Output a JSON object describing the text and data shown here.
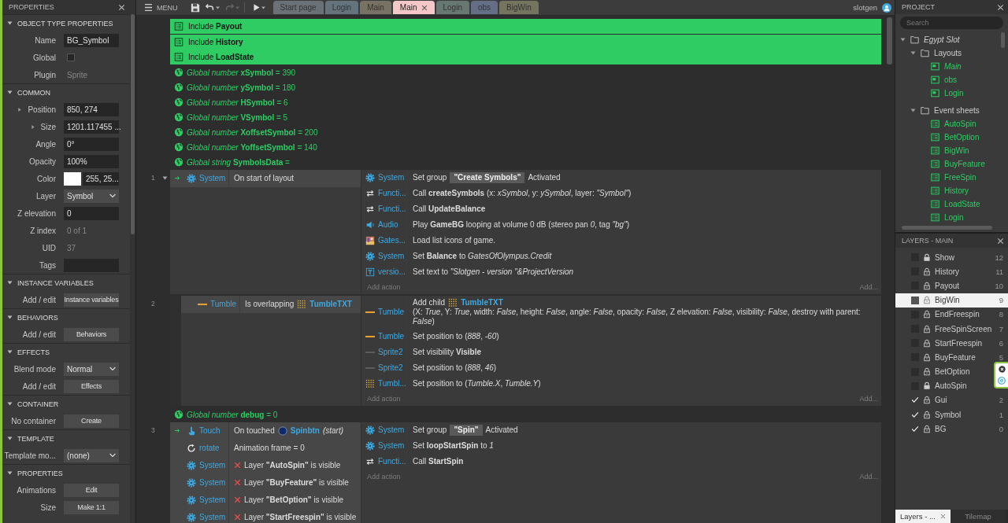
{
  "properties_panel": {
    "title": "PROPERTIES",
    "sections": [
      {
        "title": "OBJECT TYPE PROPERTIES",
        "expanded": true,
        "rows": [
          {
            "label": "Name",
            "kind": "field",
            "value": "BG_Symbol"
          },
          {
            "label": "Global",
            "kind": "check",
            "checked": false
          },
          {
            "label": "Plugin",
            "kind": "text",
            "value": "Sprite"
          }
        ]
      },
      {
        "title": "COMMON",
        "expanded": true,
        "rows": [
          {
            "label": "Position",
            "kind": "field",
            "value": "850, 274",
            "expanded": false
          },
          {
            "label": "Size",
            "kind": "field",
            "value": "1201.117455 ...",
            "expanded": false
          },
          {
            "label": "Angle",
            "kind": "field",
            "value": "0°"
          },
          {
            "label": "Opacity",
            "kind": "field",
            "value": "100%"
          },
          {
            "label": "Color",
            "kind": "color",
            "color": "#ffffff",
            "value": "255, 25..."
          },
          {
            "label": "Layer",
            "kind": "select",
            "value": "Symbol"
          },
          {
            "label": "Z elevation",
            "kind": "field",
            "value": "0"
          },
          {
            "label": "Z index",
            "kind": "text",
            "value": "0 of 1"
          },
          {
            "label": "UID",
            "kind": "text",
            "value": "37"
          },
          {
            "label": "Tags",
            "kind": "field"
          }
        ]
      },
      {
        "title": "INSTANCE VARIABLES",
        "expanded": true,
        "rows": [
          {
            "label": "Add / edit",
            "kind": "button",
            "value": "Instance variables"
          }
        ]
      },
      {
        "title": "BEHAVIORS",
        "expanded": true,
        "rows": [
          {
            "label": "Add / edit",
            "kind": "button",
            "value": "Behaviors"
          }
        ]
      },
      {
        "title": "EFFECTS",
        "expanded": true,
        "rows": [
          {
            "label": "Blend mode",
            "kind": "select",
            "value": "Normal"
          },
          {
            "label": "Add / edit",
            "kind": "button",
            "value": "Effects"
          }
        ]
      },
      {
        "title": "CONTAINER",
        "expanded": true,
        "rows": [
          {
            "label": "No container",
            "kind": "button",
            "value": "Create"
          }
        ]
      },
      {
        "title": "TEMPLATE",
        "expanded": true,
        "rows": [
          {
            "label": "Template mo...",
            "kind": "select",
            "value": "(none)"
          }
        ]
      },
      {
        "title": "PROPERTIES",
        "expanded": true,
        "rows": [
          {
            "label": "Animations",
            "kind": "button",
            "value": "Edit"
          },
          {
            "label": "Size",
            "kind": "button",
            "value": "Make 1:1"
          }
        ]
      }
    ]
  },
  "toolbar": {
    "menu": "MENU",
    "tabs": [
      {
        "label": "Start page",
        "selected": false,
        "color": "#6a7177"
      },
      {
        "label": "Login",
        "selected": false,
        "color": "#65747c"
      },
      {
        "label": "Main",
        "selected": false,
        "color": "#777263"
      },
      {
        "label": "Main",
        "selected": true,
        "color": "#f6c7c7"
      },
      {
        "label": "Login",
        "selected": false,
        "color": "#677771"
      },
      {
        "label": "obs",
        "selected": false,
        "color": "#646e86"
      },
      {
        "label": "BigWin",
        "selected": false,
        "color": "#75745e"
      }
    ],
    "user": "slotgen"
  },
  "event_sheet": {
    "rows": [
      {
        "kind": "include",
        "text": "Include **Payout**"
      },
      {
        "kind": "include",
        "text": "Include **History**"
      },
      {
        "kind": "include",
        "text": "Include **LoadState**"
      },
      {
        "kind": "global",
        "text": "*Global number* **xSymbol** = 390"
      },
      {
        "kind": "global",
        "text": "*Global number* **ySymbol** = 180"
      },
      {
        "kind": "global",
        "text": "*Global number* **HSymbol** = 6"
      },
      {
        "kind": "global",
        "text": "*Global number* **VSymbol** = 5"
      },
      {
        "kind": "global",
        "text": "*Global number* **XoffsetSymbol** = 200"
      },
      {
        "kind": "global",
        "text": "*Global number* **YoffsetSymbol** = 140"
      },
      {
        "kind": "global",
        "text": "*Global string* **SymbolsData** ="
      },
      {
        "kind": "event",
        "number": "1",
        "expanded": true,
        "trigger": true,
        "sub": false,
        "add_action": "Add action",
        "add_more": "Add...",
        "conditions": [
          {
            "object": "System",
            "kind": "system",
            "text": "On start of layout"
          }
        ],
        "actions": [
          {
            "object": "System",
            "kind": "system",
            "parts": [
              {
                "kind": "text",
                "text": "Set group"
              },
              {
                "kind": "chip",
                "text": "\"Create Symbols\""
              },
              {
                "kind": "text",
                "text": "Activated"
              }
            ]
          },
          {
            "object": "Functi...",
            "kind": "function",
            "text": "Call **createSymbols** (x: *xSymbol*, y: *ySymbol*, layer: *\"Symbol\"*)"
          },
          {
            "object": "Functi...",
            "kind": "function",
            "text": "Call **UpdateBalance**"
          },
          {
            "object": "Audio",
            "kind": "audio",
            "text": "Play **GameBG** looping at volume 0 dB (stereo pan *0*, tag *\"bg\"*)"
          },
          {
            "object": "Gates...",
            "kind": "image",
            "text": "Load list icons of game."
          },
          {
            "object": "System",
            "kind": "system",
            "text": "Set **Balance** to *GatesOfOlympus.Credit*"
          },
          {
            "object": "versio...",
            "kind": "text",
            "text": "Set text to *\"Slotgen - version \"&ProjectVersion*"
          }
        ]
      },
      {
        "kind": "event",
        "number": "2",
        "trigger": false,
        "sub": true,
        "add_action": "Add action",
        "add_more": "Add...",
        "conditions": [
          {
            "object": "Tumble",
            "kind": "bar",
            "parts": [
              {
                "kind": "text",
                "text": "Is overlapping"
              },
              {
                "kind": "grid_ref",
                "text": "TumbleTXT"
              }
            ]
          }
        ],
        "actions": [
          {
            "object": "Tumble",
            "kind": "bar",
            "parts": [
              {
                "kind": "text",
                "text": "Add child"
              },
              {
                "kind": "grid_ref",
                "text": "TumbleTXT"
              },
              {
                "kind": "text",
                "text": "(X: *True*, Y: *True*, width: *False*, height: *False*, angle: *False*, opacity: *False*, Z elevation: *False*, visibility: *False*, destroy with parent: *False*)"
              }
            ]
          },
          {
            "object": "Tumble",
            "kind": "bar",
            "text": "Set position to (*888*, *-60*)"
          },
          {
            "object": "Sprite2",
            "kind": "line",
            "text": "Set visibility **Visible**"
          },
          {
            "object": "Sprite2",
            "kind": "line",
            "text": "Set position to (*888*, *46*)"
          },
          {
            "object": "Tumbl...",
            "kind": "grid",
            "text": "Set position to (*Tumble.X*, *Tumble.Y*)"
          }
        ]
      },
      {
        "kind": "global",
        "text": "*Global number* **debug** = 0"
      },
      {
        "kind": "event",
        "number": "3",
        "trigger": true,
        "sub": false,
        "add_action": "Add action",
        "add_more": "Add...",
        "conditions": [
          {
            "object": "Touch",
            "kind": "touch",
            "parts": [
              {
                "kind": "text",
                "text": "On touched"
              },
              {
                "kind": "ball_ref",
                "text": "Spinbtn"
              },
              {
                "kind": "text",
                "text": "*(start)*"
              }
            ]
          },
          {
            "object": "rotate",
            "kind": "rotate",
            "text": "Animation frame = 0"
          },
          {
            "object": "System",
            "kind": "system",
            "inverted": true,
            "text": "Layer **\"AutoSpin\"** is visible"
          },
          {
            "object": "System",
            "kind": "system",
            "inverted": true,
            "text": "Layer **\"BuyFeature\"** is visible"
          },
          {
            "object": "System",
            "kind": "system",
            "inverted": true,
            "text": "Layer **\"BetOption\"** is visible"
          },
          {
            "object": "System",
            "kind": "system",
            "inverted": true,
            "text": "Layer **\"StartFreespin\"** is visible"
          }
        ],
        "actions": [
          {
            "object": "System",
            "kind": "system",
            "parts": [
              {
                "kind": "text",
                "text": "Set group"
              },
              {
                "kind": "chip",
                "text": "\"Spin\""
              },
              {
                "kind": "text",
                "text": "Activated"
              }
            ]
          },
          {
            "object": "System",
            "kind": "system",
            "text": "Set **loopStartSpin** to *1*"
          },
          {
            "object": "Functi...",
            "kind": "function",
            "text": "Call **StartSpin**"
          }
        ]
      }
    ]
  },
  "project": {
    "title": "PROJECT",
    "search": {
      "placeholder": "Search"
    },
    "tree": [
      {
        "kind": "folder",
        "label": "Egypt Slot",
        "expanded": true,
        "children": [
          {
            "kind": "folder",
            "label": "Layouts",
            "expanded": true,
            "children": [
              {
                "kind": "layout",
                "label": "Main",
                "active": true
              },
              {
                "kind": "layout",
                "label": "obs",
                "active": false
              },
              {
                "kind": "layout",
                "label": "Login",
                "active": false
              }
            ]
          },
          {
            "kind": "folder",
            "label": "Event sheets",
            "expanded": true,
            "children": [
              {
                "kind": "sheet",
                "label": "AutoSpin"
              },
              {
                "kind": "sheet",
                "label": "BetOption"
              },
              {
                "kind": "sheet",
                "label": "BigWin"
              },
              {
                "kind": "sheet",
                "label": "BuyFeature"
              },
              {
                "kind": "sheet",
                "label": "FreeSpin"
              },
              {
                "kind": "sheet",
                "label": "History"
              },
              {
                "kind": "sheet",
                "label": "LoadState"
              },
              {
                "kind": "sheet",
                "label": "Login"
              }
            ]
          }
        ]
      }
    ]
  },
  "layers": {
    "title": "LAYERS - MAIN",
    "items": [
      {
        "name": "Show",
        "number": "12",
        "visible": false,
        "locked": true,
        "selected": false
      },
      {
        "name": "History",
        "number": "11",
        "visible": false,
        "locked": false,
        "selected": false
      },
      {
        "name": "Payout",
        "number": "10",
        "visible": false,
        "locked": false,
        "selected": false
      },
      {
        "name": "BigWin",
        "number": "9",
        "visible": false,
        "locked": false,
        "selected": true
      },
      {
        "name": "EndFreespin",
        "number": "8",
        "visible": false,
        "locked": false,
        "selected": false
      },
      {
        "name": "FreeSpinScreen",
        "number": "7",
        "visible": false,
        "locked": false,
        "selected": false
      },
      {
        "name": "StartFreespin",
        "number": "6",
        "visible": false,
        "locked": false,
        "selected": false
      },
      {
        "name": "BuyFeature",
        "number": "5",
        "visible": false,
        "locked": false,
        "selected": false
      },
      {
        "name": "BetOption",
        "visible": false,
        "locked": false,
        "selected": false
      },
      {
        "name": "AutoSpin",
        "visible": false,
        "locked": true,
        "selected": false
      },
      {
        "name": "Gui",
        "number": "2",
        "visible": true,
        "locked": false,
        "selected": false
      },
      {
        "name": "Symbol",
        "number": "1",
        "visible": true,
        "locked": false,
        "selected": false
      },
      {
        "name": "BG",
        "number": "0",
        "visible": true,
        "locked": false,
        "selected": false
      }
    ],
    "tabs": [
      {
        "label": "Layers - ...",
        "selected": true
      },
      {
        "label": "Tilemap",
        "selected": false
      }
    ]
  }
}
